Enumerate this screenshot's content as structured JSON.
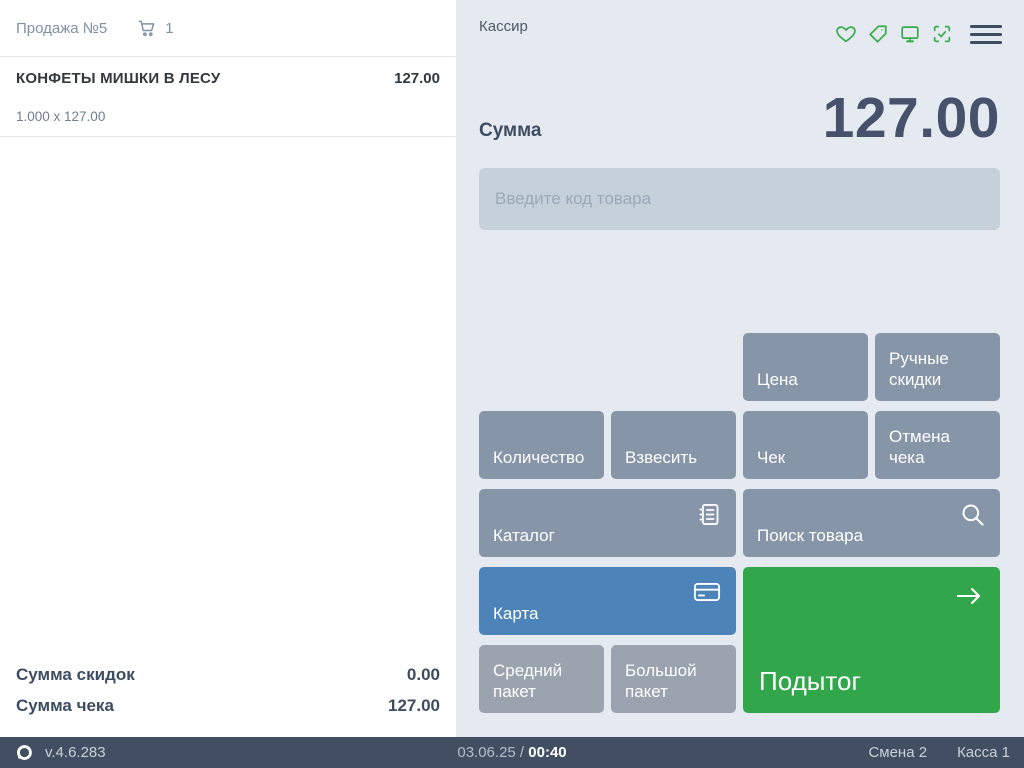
{
  "left_panel": {
    "sale_title": "Продажа №5",
    "cart_count": "1",
    "item": {
      "name": "КОНФЕТЫ МИШКИ В ЛЕСУ",
      "total": "127.00",
      "qty_line": "1.000 x 127.00"
    },
    "summary": {
      "discount_label": "Сумма скидок",
      "discount_value": "0.00",
      "total_label": "Сумма чека",
      "total_value": "127.00"
    }
  },
  "right_panel": {
    "cashier_label": "Кассир",
    "sum_label": "Сумма",
    "sum_value": "127.00",
    "input_placeholder": "Введите код товара",
    "buttons": {
      "price": "Цена",
      "manual_discounts": "Ручные скидки",
      "quantity": "Количество",
      "weigh": "Взвесить",
      "receipt": "Чек",
      "cancel_receipt": "Отмена чека",
      "catalog": "Каталог",
      "search": "Поиск товара",
      "card": "Карта",
      "subtotal": "Подытог",
      "medium_bag": "Средний пакет",
      "big_bag": "Большой пакет"
    },
    "header_icons": [
      "heart-icon",
      "tag-icon",
      "display-icon",
      "scan-check-icon",
      "menu-icon"
    ]
  },
  "status_bar": {
    "version": "v.4.6.283",
    "date": "03.06.25",
    "separator": "/",
    "time": "00:40",
    "shift": "Смена 2",
    "register": "Касса 1"
  },
  "colors": {
    "accent_green": "#31a64a",
    "icon_green": "#3cab50",
    "accent_blue": "#4c84ba",
    "button_gray": "#8695a7",
    "bag_button_gray": "#9aa3ae",
    "panel_bg": "#e4eaf0",
    "input_bg": "#c6d0db",
    "dark_text": "#3e4c62",
    "statusbar_bg": "#424f63"
  }
}
